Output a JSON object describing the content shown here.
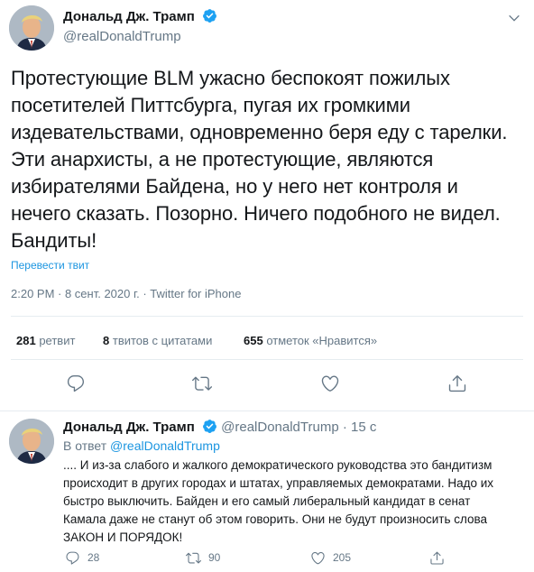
{
  "main_tweet": {
    "author_name": "Дональд Дж. Трамп",
    "handle": "@realDonaldTrump",
    "text": "Протестующие BLM ужасно беспокоят пожилых посетителей Питтсбурга, пугая их громкими издевательствами, одновременно беря еду с тарелки. Эти анархисты, а не протестующие, являются избирателями Байдена, но у него нет контроля и нечего сказать. Позорно. Ничего подобного не видел. Бандиты!",
    "translate_label": "Перевести твит",
    "meta": "2:20 PM · 8 сент. 2020 г. · Twitter for iPhone",
    "stats": {
      "retweets_count": "281",
      "retweets_label": "ретвит",
      "quotes_count": "8",
      "quotes_label": "твитов с цитатами",
      "likes_count": "655",
      "likes_label": "отметок «Нравится»"
    },
    "icons": [
      "reply-icon",
      "retweet-icon",
      "like-icon",
      "share-icon"
    ]
  },
  "reply_tweet": {
    "author_name": "Дональд Дж. Трамп",
    "handle": "@realDonaldTrump",
    "time": "· 15 с",
    "replying_prefix": "В ответ",
    "replying_to": "@realDonaldTrump",
    "text": ".... И из-за слабого и жалкого демократического руководства это бандитизм происходит в других городах и штатах, управляемых демократами. Надо их быстро выключить. Байден и его самый либеральный кандидат в сенат Камала даже не станут об этом говорить. Они не будут произносить слова ЗАКОН И ПОРЯДОК!",
    "actions": {
      "replies": "28",
      "retweets": "90",
      "likes": "205"
    }
  },
  "colors": {
    "accent": "#1da1f2",
    "link": "#1b95e0",
    "secondary_text": "#657786",
    "primary_text": "#14171a",
    "divider": "#e6ecf0"
  }
}
